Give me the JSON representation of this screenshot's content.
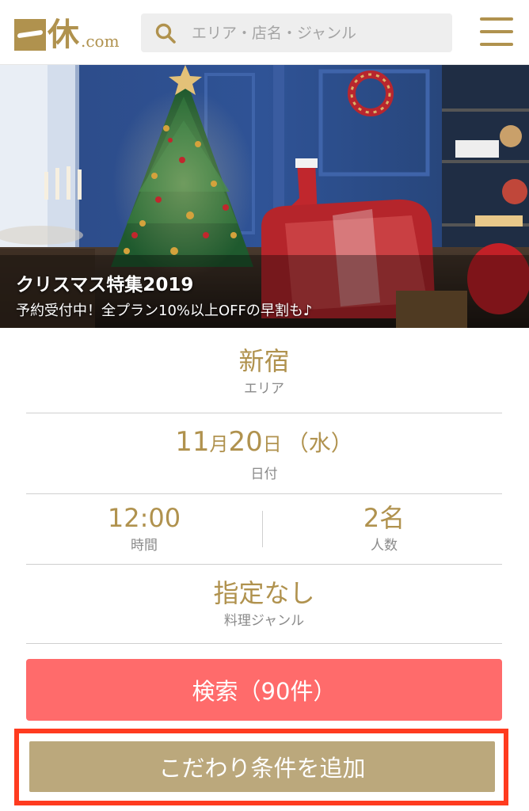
{
  "header": {
    "logo_kanji": "休",
    "logo_com": ".com",
    "search_placeholder": "エリア・店名・ジャンル"
  },
  "banner": {
    "title": "クリスマス特集2019",
    "subtitle": "予約受付中！全プラン10%以上OFFの早割も♪"
  },
  "form": {
    "area": {
      "value": "新宿",
      "label": "エリア"
    },
    "date": {
      "month": "11",
      "month_unit": "月",
      "day": "20",
      "day_unit": "日",
      "weekday": "（水）",
      "label": "日付"
    },
    "time": {
      "value": "12:00",
      "label": "時間"
    },
    "people": {
      "value": "2名",
      "label": "人数"
    },
    "genre": {
      "value": "指定なし",
      "label": "料理ジャンル"
    }
  },
  "buttons": {
    "search": "検索（90件）",
    "more_conditions": "こだわり条件を追加"
  },
  "colors": {
    "brand_gold": "#b0924e",
    "search_button": "#ff6b6b",
    "more_button": "#bba87c",
    "highlight_border": "#ff3b1f"
  }
}
